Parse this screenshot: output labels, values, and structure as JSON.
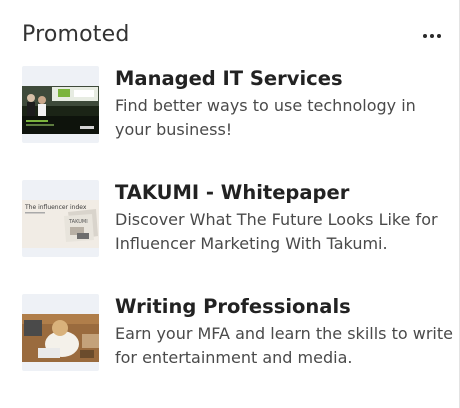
{
  "panel": {
    "title": "Promoted",
    "more_icon": "more-horizontal-icon"
  },
  "ads": [
    {
      "name": "Managed IT Services",
      "description": "Find better ways to use technology in your business!",
      "thumbnail": "office-people-thumbnail"
    },
    {
      "name": "TAKUMI - Whitepaper",
      "description": "Discover What The Future Looks Like for Influencer Marketing With Takumi.",
      "thumbnail": "influencer-index-thumbnail",
      "thumbnail_text": "The influencer index",
      "thumbnail_brand": "TAKUMI"
    },
    {
      "name": "Writing Professionals",
      "description": "Earn your MFA and learn the skills to write for entertainment and media.",
      "thumbnail": "person-writing-thumbnail"
    }
  ]
}
